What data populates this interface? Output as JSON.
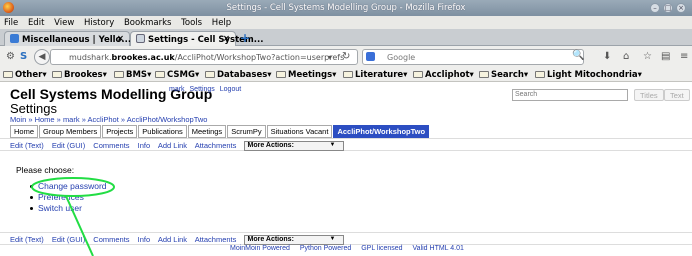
{
  "window": {
    "title": "Settings - Cell Systems Modelling Group - Mozilla Firefox"
  },
  "menu": [
    "File",
    "Edit",
    "View",
    "History",
    "Bookmarks",
    "Tools",
    "Help"
  ],
  "tabs": [
    {
      "label": "Miscellaneous | Yello..."
    },
    {
      "label": "Settings - Cell System..."
    }
  ],
  "nav": {
    "url_prefix": "mudshark.",
    "url_domain": "brookes.ac.uk",
    "url_path": "/AccliPhot/WorkshopTwo?action=userprefs",
    "search_placeholder": "Google"
  },
  "bookmarks": [
    "Other",
    "Brookes",
    "BMS",
    "CSMG",
    "Databases",
    "Meetings",
    "Literature",
    "Accliphot",
    "Search",
    "Light Mitochondria"
  ],
  "site": {
    "name": "Cell Systems Modelling Group",
    "user_links": [
      "mark",
      "Settings",
      "Logout"
    ],
    "search_placeholder": "Search",
    "titles_button": "Titles",
    "text_button": "Text"
  },
  "page": {
    "title": "Settings",
    "breadcrumb": "Moin » Home » mark » AccliPhot » AccliPhot/WorkshopTwo",
    "navtabs": [
      "Home",
      "Group Members",
      "Projects",
      "Publications",
      "Meetings",
      "ScrumPy",
      "Situations Vacant",
      "AccliPhot/WorkshopTwo"
    ],
    "edit_links": [
      "Edit (Text)",
      "Edit (GUI)",
      "Comments",
      "Info",
      "Add Link",
      "Attachments"
    ],
    "more_actions": "More Actions:",
    "prompt": "Please choose:",
    "choices": [
      "Change password",
      "Preferences",
      "Switch user"
    ],
    "footer": [
      "MoinMoin Powered",
      "Python Powered",
      "GPL licensed",
      "Valid HTML 4.01"
    ]
  },
  "colors": {
    "link": "#2640b0",
    "current_tab": "#2c4ec2",
    "annotation": "#22dd44"
  }
}
